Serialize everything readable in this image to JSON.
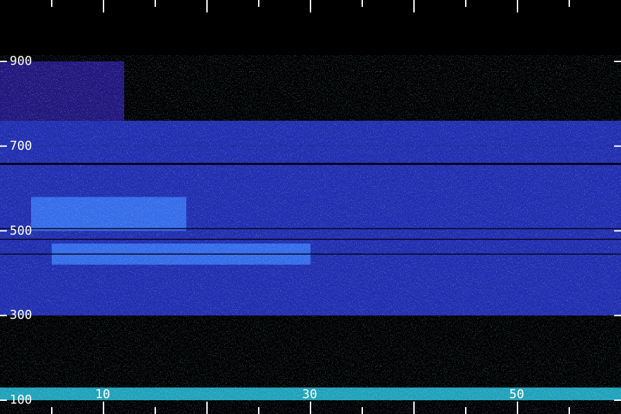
{
  "chart_data": {
    "type": "heatmap",
    "title": "",
    "xlabel": "",
    "ylabel": "",
    "x_tick_labels": [
      "10",
      "30",
      "50"
    ],
    "x_ticks_all": [
      5,
      10,
      15,
      20,
      25,
      30,
      35,
      40,
      45,
      50,
      55
    ],
    "y_tick_labels": [
      "900",
      "700",
      "500",
      "300",
      "100"
    ],
    "xlim": [
      0,
      60
    ],
    "ylim": [
      100,
      1000
    ],
    "colormap": [
      "#000000",
      "#1a0a4a",
      "#2a1aa0",
      "#2a3ae0",
      "#3a7aff",
      "#2ad0ff",
      "#40ff80"
    ],
    "intensity_bands": [
      {
        "freq": [
          700,
          760
        ],
        "x": [
          0,
          60
        ],
        "level": 0.45
      },
      {
        "freq": [
          300,
          700
        ],
        "x": [
          0,
          60
        ],
        "level": 0.55
      },
      {
        "freq": [
          420,
          470
        ],
        "x": [
          5,
          30
        ],
        "level": 0.7
      },
      {
        "freq": [
          500,
          580
        ],
        "x": [
          3,
          18
        ],
        "level": 0.62
      },
      {
        "freq": [
          760,
          900
        ],
        "x": [
          0,
          12
        ],
        "level": 0.3
      },
      {
        "freq": [
          100,
          130
        ],
        "x": [
          0,
          60
        ],
        "level": 0.85
      }
    ],
    "dark_lines_freq": [
      658,
      505,
      480,
      445
    ],
    "grid": false,
    "legend": "none"
  }
}
